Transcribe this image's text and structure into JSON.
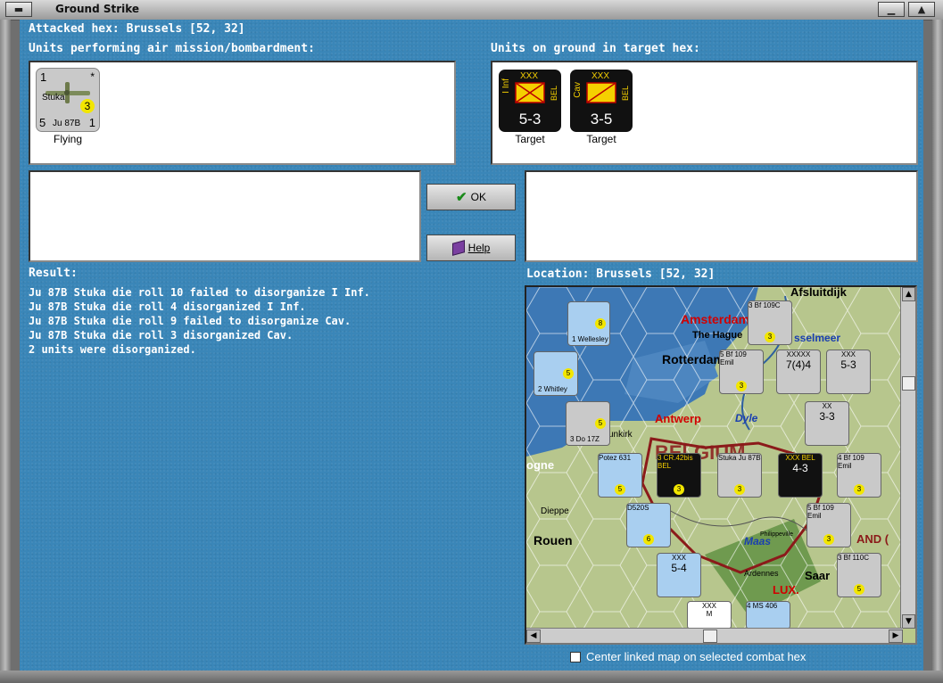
{
  "window": {
    "title": "Ground Strike"
  },
  "header": {
    "attacked_hex": "Attacked hex: Brussels [52, 32]",
    "air_units_label": "Units performing air mission/bombardment:",
    "ground_units_label": "Units on ground in target hex:"
  },
  "air_units": [
    {
      "name": "Stuka",
      "type": "Ju 87B",
      "top_left": "1",
      "top_right": "*",
      "bottom_left": "5",
      "bottom_right": "1",
      "badge": "3",
      "status": "Flying"
    }
  ],
  "ground_units": [
    {
      "branch": "I Inf",
      "size": "XXX",
      "nation": "BEL",
      "strength": "5-3",
      "status": "Target"
    },
    {
      "branch": "Cav",
      "size": "XXX",
      "nation": "BEL",
      "strength": "3-5",
      "status": "Target"
    }
  ],
  "buttons": {
    "ok": "OK",
    "help": "Help"
  },
  "result": {
    "label": "Result:",
    "lines": [
      "Ju 87B Stuka die roll 10 failed to disorganize I Inf.",
      "Ju 87B Stuka die roll 4 disorganized I Inf.",
      "Ju 87B Stuka die roll 9 failed to disorganize Cav.",
      "Ju 87B Stuka die roll 3 disorganized Cav.",
      "2 units were disorganized."
    ]
  },
  "location": {
    "label": "Location: Brussels [52, 32]",
    "map_labels": {
      "amsterdam": "Amsterdam",
      "hague": "The Hague",
      "rotterdam": "Rotterdam",
      "antwerp": "Antwerp",
      "dyle": "Dyle",
      "belgium": "BELGIUM",
      "dieppe": "Dieppe",
      "rouen": "Rouen",
      "maas": "Maas",
      "ardennes": "Ardennes",
      "lux": "LUX.",
      "afsluitdijk": "Afsluitdijk",
      "ijsselmeer": "sselmeer",
      "dunkirk": "unkirk",
      "boulogne": "ogne",
      "saar": "Saar",
      "holland": "AND (",
      "philippeville": "Philippeville"
    },
    "map_counters": [
      {
        "top": "3 Bf 109C",
        "badge": "3"
      },
      {
        "top": "5 Bf 109",
        "sub": "Emil",
        "badge": "3"
      },
      {
        "top": "XXXXX",
        "bottom": "7(4)4"
      },
      {
        "top": "XXX",
        "bottom": "5-3"
      },
      {
        "top": "XX",
        "bottom": "3-3"
      },
      {
        "top": "Potez 631",
        "badge": "5"
      },
      {
        "top": "3 CR.42bis",
        "sub": "BEL",
        "badge": "3"
      },
      {
        "top": "Stuka Ju 87B",
        "badge": "3"
      },
      {
        "top": "XXX",
        "sub": "BEL",
        "bottom": "4-3"
      },
      {
        "top": "4 Bf 109",
        "sub": "Emil",
        "badge": "3"
      },
      {
        "top": "D520S",
        "badge": "6"
      },
      {
        "top": "5 Bf 109",
        "sub": "Emil",
        "badge": "3"
      },
      {
        "top": "XXX",
        "bottom": "5-4"
      },
      {
        "top": "3 Bf 110C",
        "badge": "5"
      },
      {
        "top": "1 Wellesley",
        "badge": "8"
      },
      {
        "top": "2 Whitley",
        "badge": "5"
      },
      {
        "top": "3 Do 17Z",
        "badge": "5"
      },
      {
        "top": "XXX",
        "bottom": "M"
      },
      {
        "top": "4 MS 406",
        "badge": ""
      }
    ]
  },
  "footer": {
    "center_checkbox": "Center linked map on selected combat hex"
  },
  "colors": {
    "background": "#3a86b8",
    "ground_counter": "#111111",
    "target_box": "#f5d000",
    "badge": "#f2e600"
  }
}
